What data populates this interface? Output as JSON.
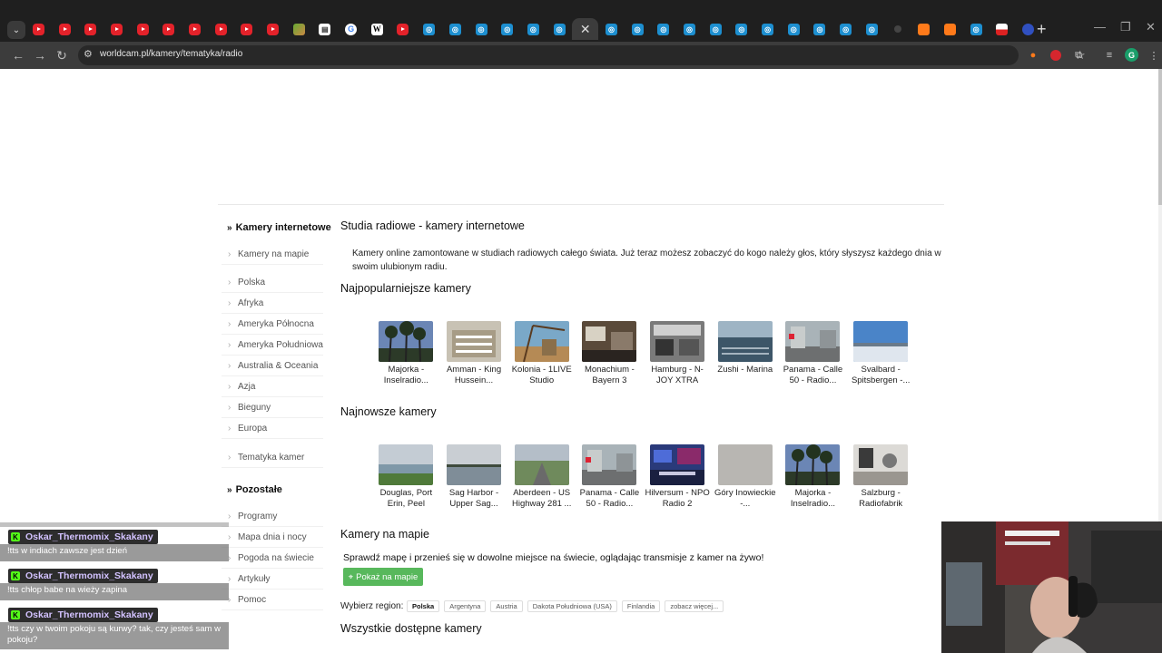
{
  "browser": {
    "tabs": [
      {
        "icon": "youtube-icon",
        "kind": "yt"
      },
      {
        "icon": "youtube-icon",
        "kind": "yt"
      },
      {
        "icon": "youtube-icon",
        "kind": "yt"
      },
      {
        "icon": "youtube-icon",
        "kind": "yt"
      },
      {
        "icon": "youtube-icon",
        "kind": "yt"
      },
      {
        "icon": "youtube-icon",
        "kind": "yt"
      },
      {
        "icon": "youtube-icon",
        "kind": "yt"
      },
      {
        "icon": "youtube-icon",
        "kind": "yt"
      },
      {
        "icon": "youtube-icon",
        "kind": "yt"
      },
      {
        "icon": "youtube-icon",
        "kind": "yt"
      },
      {
        "icon": "mixed-favicon",
        "kind": "mix"
      },
      {
        "icon": "note-icon",
        "kind": "note"
      },
      {
        "icon": "google-icon",
        "kind": "g"
      },
      {
        "icon": "wikipedia-icon",
        "kind": "w"
      },
      {
        "icon": "youtube-icon",
        "kind": "yt"
      },
      {
        "icon": "worldcam-icon",
        "kind": "cam"
      },
      {
        "icon": "worldcam-icon",
        "kind": "cam"
      },
      {
        "icon": "worldcam-icon",
        "kind": "cam"
      },
      {
        "icon": "worldcam-icon",
        "kind": "cam"
      },
      {
        "icon": "worldcam-icon",
        "kind": "cam"
      },
      {
        "icon": "worldcam-icon",
        "kind": "cam"
      },
      {
        "icon": "close-icon",
        "kind": "active"
      },
      {
        "icon": "worldcam-icon",
        "kind": "cam"
      },
      {
        "icon": "worldcam-icon",
        "kind": "cam"
      },
      {
        "icon": "worldcam-icon",
        "kind": "cam"
      },
      {
        "icon": "worldcam-icon",
        "kind": "cam"
      },
      {
        "icon": "worldcam-icon",
        "kind": "cam"
      },
      {
        "icon": "worldcam-icon",
        "kind": "cam"
      },
      {
        "icon": "worldcam-icon",
        "kind": "cam"
      },
      {
        "icon": "worldcam-icon",
        "kind": "cam"
      },
      {
        "icon": "worldcam-icon",
        "kind": "cam"
      },
      {
        "icon": "worldcam-icon",
        "kind": "cam"
      },
      {
        "icon": "worldcam-icon",
        "kind": "cam"
      },
      {
        "icon": "dot-icon",
        "kind": "dark"
      },
      {
        "icon": "orange-icon",
        "kind": "orange"
      },
      {
        "icon": "orange-icon",
        "kind": "orange"
      },
      {
        "icon": "worldcam-icon",
        "kind": "cam"
      },
      {
        "icon": "flag-icon",
        "kind": "flag"
      },
      {
        "icon": "blue-dot-icon",
        "kind": "blue"
      }
    ],
    "active_tab_close": "✕",
    "new_tab": "+",
    "url": "worldcam.pl/kamery/tematyka/radio",
    "profile_initial": "G"
  },
  "sidebar": {
    "head1": "Kamery internetowe",
    "map_link": "Kamery na mapie",
    "regions": [
      "Polska",
      "Afryka",
      "Ameryka Północna",
      "Ameryka Południowa",
      "Australia & Oceania",
      "Azja",
      "Bieguny",
      "Europa"
    ],
    "topics_link": "Tematyka kamer",
    "head2": "Pozostałe",
    "other": [
      "Programy",
      "Mapa dnia i nocy",
      "Pogoda na świecie",
      "Artykuły",
      "Pomoc"
    ]
  },
  "main": {
    "title": "Studia radiowe - kamery internetowe",
    "description": "Kamery online zamontowane w studiach radiowych całego świata. Już teraz możesz zobaczyć do kogo należy głos, który słyszysz każdego dnia w swoim ulubionym radiu.",
    "popular_heading": "Najpopularniejsze kamery",
    "popular": [
      {
        "caption": "Majorka - Inselradio...",
        "scene": "palms"
      },
      {
        "caption": "Amman - King Hussein...",
        "scene": "building"
      },
      {
        "caption": "Kolonia - 1LIVE Studio",
        "scene": "crane"
      },
      {
        "caption": "Monachium - Bayern 3",
        "scene": "studio"
      },
      {
        "caption": "Hamburg - N-JOY XTRA",
        "scene": "studio-bw"
      },
      {
        "caption": "Zushi - Marina",
        "scene": "marina"
      },
      {
        "caption": "Panama - Calle 50 - Radio...",
        "scene": "street"
      },
      {
        "caption": "Svalbard - Spitsbergen -...",
        "scene": "arctic"
      }
    ],
    "newest_heading": "Najnowsze kamery",
    "newest": [
      {
        "caption": "Douglas, Port Erin, Peel",
        "scene": "coast"
      },
      {
        "caption": "Sag Harbor - Upper Sag...",
        "scene": "harbor"
      },
      {
        "caption": "Aberdeen - US Highway 281 ...",
        "scene": "highway"
      },
      {
        "caption": "Panama - Calle 50 - Radio...",
        "scene": "street"
      },
      {
        "caption": "Hilversum - NPO Radio 2",
        "scene": "studio-blue"
      },
      {
        "caption": "Góry Inowieckie -...",
        "scene": "grey"
      },
      {
        "caption": "Majorka - Inselradio...",
        "scene": "palms"
      },
      {
        "caption": "Salzburg - Radiofabrik",
        "scene": "studio-white"
      }
    ],
    "map_heading": "Kamery na mapie",
    "map_text": "Sprawdź mapę i przenieś się w dowolne miejsce na świecie, oglądając transmisje z kamer na żywo!",
    "map_button": "Pokaż na mapie",
    "region_label": "Wybierz region:",
    "region_chips": [
      "Polska",
      "Argentyna",
      "Austria",
      "Dakota Południowa (USA)",
      "Finlandia",
      "zobacz więcej..."
    ],
    "all_heading": "Wszystkie dostępne kamery"
  },
  "chat": [
    {
      "user": "Oskar_Thermomix_Skakany",
      "message": "!tts w indiach zawsze jest dzień"
    },
    {
      "user": "Oskar_Thermomix_Skakany",
      "message": "!tts chłop babe na wieży zapina"
    },
    {
      "user": "Oskar_Thermomix_Skakany",
      "message": "!tts czy w twoim pokoju są kurwy? tak, czy jesteś sam w pokoju?"
    }
  ],
  "colors": {
    "accent_green": "#58b85c",
    "kick_green": "#53fc18",
    "chat_name": "#d3c2ff"
  }
}
